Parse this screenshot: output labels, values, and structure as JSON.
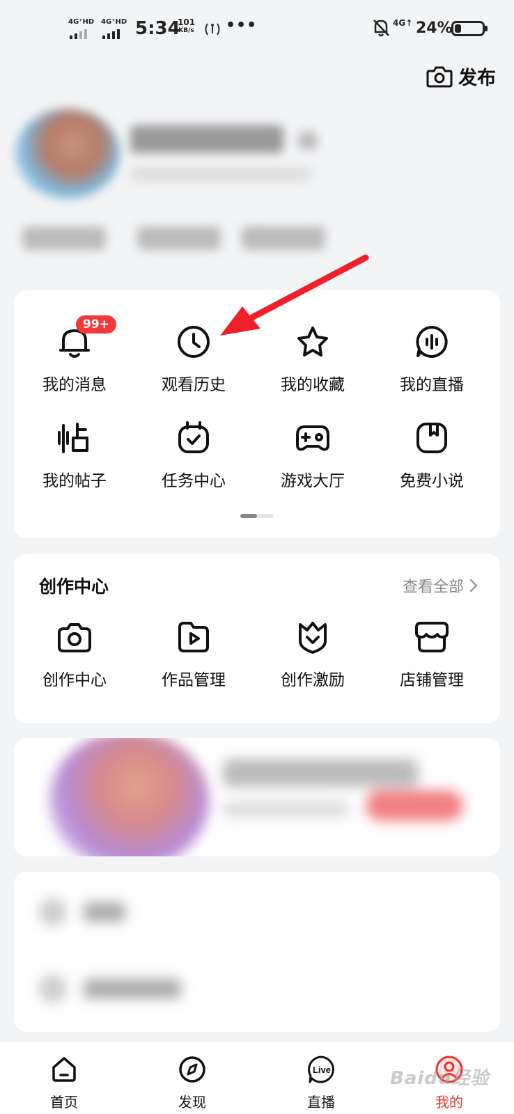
{
  "status_bar": {
    "sim1": "4G⁺HD",
    "sim2": "4G⁺HD",
    "time": "5:34",
    "speed_value": "101",
    "speed_unit": "KB/s",
    "more": "•••",
    "network": "4G↑",
    "battery": "24%",
    "battery_level": 0.24
  },
  "header": {
    "publish_label": "发布",
    "publish_icon": "camera-icon"
  },
  "shortcuts": {
    "items": [
      {
        "label": "我的消息",
        "icon": "bell-icon",
        "badge": "99+"
      },
      {
        "label": "观看历史",
        "icon": "clock-icon"
      },
      {
        "label": "我的收藏",
        "icon": "star-icon"
      },
      {
        "label": "我的直播",
        "icon": "live-mic-icon"
      },
      {
        "label": "我的帖子",
        "icon": "post-icon"
      },
      {
        "label": "任务中心",
        "icon": "calendar-check-icon"
      },
      {
        "label": "游戏大厅",
        "icon": "gamepad-icon"
      },
      {
        "label": "免费小说",
        "icon": "book-icon"
      }
    ],
    "page_index": 1,
    "page_count": 2
  },
  "creation_center": {
    "title": "创作中心",
    "view_all": "查看全部",
    "items": [
      {
        "label": "创作中心",
        "icon": "camera-icon"
      },
      {
        "label": "作品管理",
        "icon": "video-folder-icon"
      },
      {
        "label": "创作激励",
        "icon": "crown-icon"
      },
      {
        "label": "店铺管理",
        "icon": "shop-icon"
      }
    ]
  },
  "bottom_nav": {
    "items": [
      {
        "label": "首页",
        "icon": "home-icon"
      },
      {
        "label": "发现",
        "icon": "compass-icon"
      },
      {
        "label": "直播",
        "icon": "live-icon",
        "icon_text": "Live"
      },
      {
        "label": "我的",
        "icon": "profile-icon",
        "active": true
      }
    ]
  },
  "watermark": "Baidu经验",
  "colors": {
    "accent": "#e8332f",
    "badge": "#f2383a",
    "background": "#f3f4f6"
  }
}
